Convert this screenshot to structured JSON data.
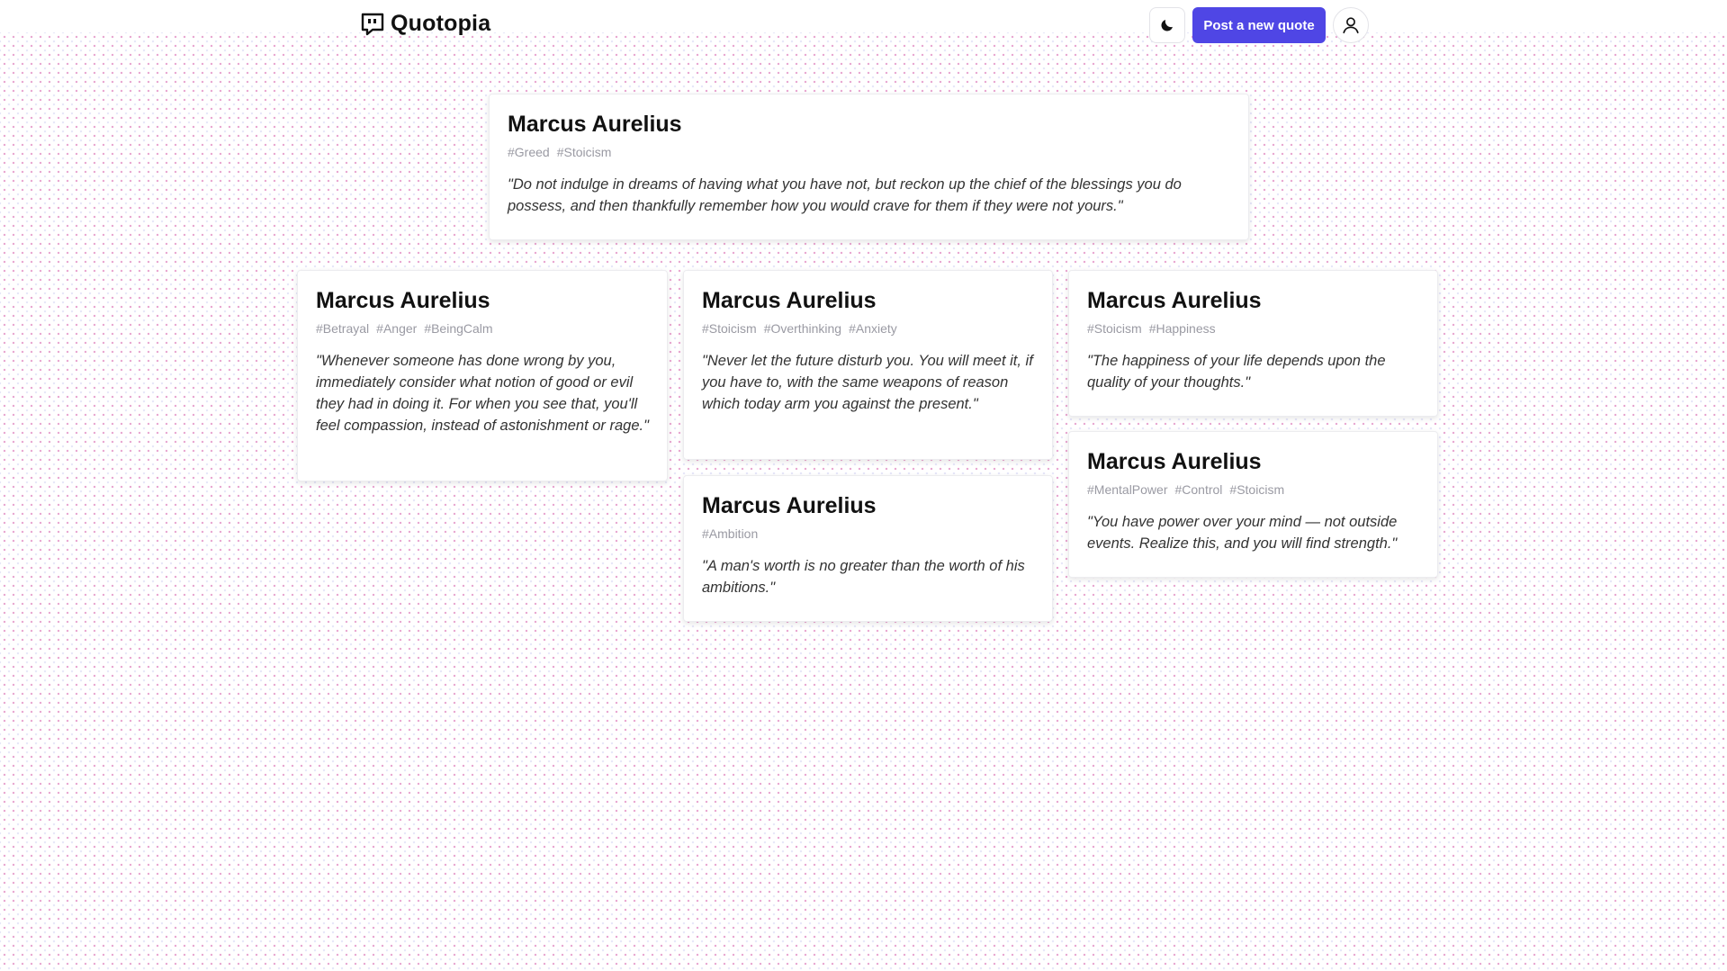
{
  "header": {
    "brand": "Quotopia",
    "post_button_label": "Post a new quote",
    "icons": {
      "logo": "quote-bubble-icon",
      "theme": "moon-icon",
      "user": "user-icon"
    }
  },
  "colors": {
    "accent": "#4f46e5",
    "tag_text": "#9a9aa3",
    "dot_primary": "#d65caa",
    "dot_secondary": "#6e6edc"
  },
  "quotes": [
    {
      "author": "Marcus Aurelius",
      "tags": [
        "#Greed",
        "#Stoicism"
      ],
      "text": "\"Do not indulge in dreams of having what you have not, but reckon up the chief of the blessings you do possess, and then thankfully remember how you would crave for them if they were not yours.\""
    },
    {
      "author": "Marcus Aurelius",
      "tags": [
        "#Betrayal",
        "#Anger",
        "#BeingCalm"
      ],
      "text": "\"Whenever someone has done wrong by you, immediately consider what notion of good or evil they had in doing it. For when you see that, you'll feel compassion, instead of astonishment or rage.\""
    },
    {
      "author": "Marcus Aurelius",
      "tags": [
        "#Stoicism",
        "#Overthinking",
        "#Anxiety"
      ],
      "text": "\"Never let the future disturb you. You will meet it, if you have to, with the same weapons of reason which today arm you against the present.\""
    },
    {
      "author": "Marcus Aurelius",
      "tags": [
        "#Stoicism",
        "#Happiness"
      ],
      "text": "\"The happiness of your life depends upon the quality of your thoughts.\""
    },
    {
      "author": "Marcus Aurelius",
      "tags": [
        "#MentalPower",
        "#Control",
        "#Stoicism"
      ],
      "text": "\"You have power over your mind — not outside events. Realize this, and you will find strength.\""
    },
    {
      "author": "Marcus Aurelius",
      "tags": [
        "#Ambition"
      ],
      "text": "\"A man's worth is no greater than the worth of his ambitions.\""
    }
  ]
}
